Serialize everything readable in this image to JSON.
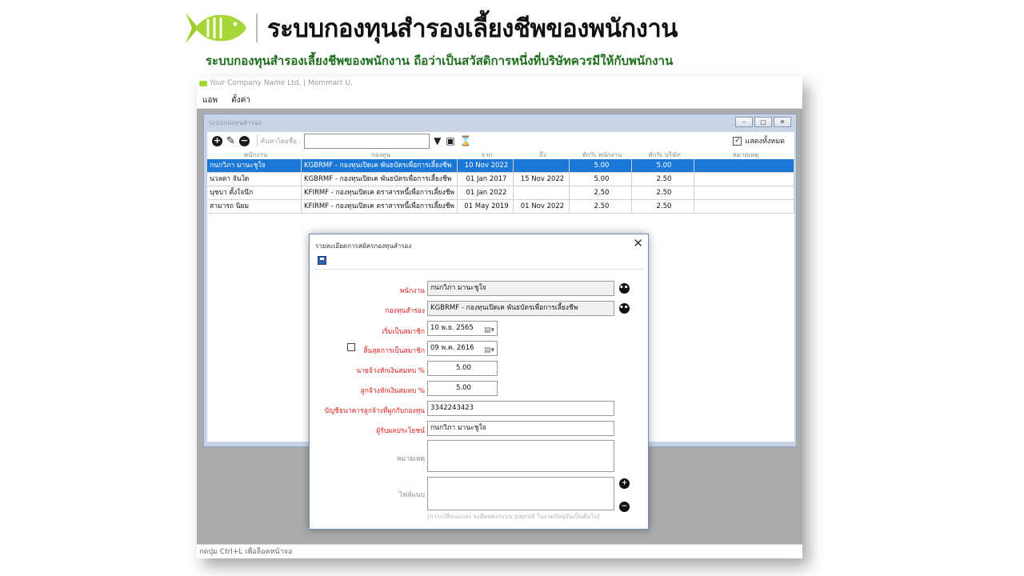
{
  "header": {
    "title": "ระบบกองทุนสำรองเลี้ยงชีพของพนักงาน",
    "subtitle": "ระบบกองทุนสำรองเลี้ยงชีพของพนักงาน ถือว่าเป็นสวัสดิการหนึ่งที่บริษัทควรมีให้กับพนักงาน"
  },
  "app": {
    "window_title": "Your Company Name Ltd. | Mommart U.",
    "menu": [
      "แอพ",
      "ตั้งค่า"
    ],
    "status_text": "กดปุ่ม Ctrl+L เพื่อล็อคหน้าจอ"
  },
  "child_window": {
    "title": "ระบบกองทุนสำรอง",
    "search_label": "ค้นหาโดยชื่อ :",
    "search_value": "",
    "show_all_label": "แสดงทั้งหมด",
    "show_all_checked": true,
    "columns": [
      "พนักงาน",
      "กองทุน",
      "จาก",
      "ถึง",
      "หัก% พนักงาน",
      "หัก% บริษัท",
      "หมายเหตุ"
    ],
    "rows": [
      {
        "employee": "กนกวิภา มานะชูใจ",
        "fund": "KGBRMF - กองทุนเปิดเค พันธบัตรเพื่อการเลี้ยงชีพ",
        "from": "10 Nov 2022",
        "to": "",
        "emp_pct": "5.00",
        "co_pct": "5.00",
        "note": "",
        "selected": true
      },
      {
        "employee": "นวลตา จันใด",
        "fund": "KGBRMF - กองทุนเปิดเค พันธบัตรเพื่อการเลี้ยงชีพ",
        "from": "01 Jan 2017",
        "to": "15 Nov 2022",
        "emp_pct": "5.00",
        "co_pct": "2.50",
        "note": "",
        "selected": false
      },
      {
        "employee": "นุชบา ตั้งใจนึก",
        "fund": "KFIRMF - กองทุนเปิดเค ตราสารหนี้เพื่อการเลี้ยงชีพ",
        "from": "01 Jan 2022",
        "to": "",
        "emp_pct": "2.50",
        "co_pct": "2.50",
        "note": "",
        "selected": false
      },
      {
        "employee": "สามารถ นิยม",
        "fund": "KFIRMF - กองทุนเปิดเค ตราสารหนี้เพื่อการเลี้ยงชีพ",
        "from": "01 May 2019",
        "to": "01 Nov 2022",
        "emp_pct": "2.50",
        "co_pct": "2.50",
        "note": "",
        "selected": false
      }
    ]
  },
  "dialog": {
    "title": "รายละเอียดการสมัครกองทุนสำรอง",
    "employee_label": "พนักงาน",
    "employee_value": "กนกวิภา มานะชูใจ",
    "fund_label": "กองทุนสำรอง",
    "fund_value": "KGBRMF - กองทุนเปิดเค พันธบัตรเพื่อการเลี้ยงชีพ",
    "start_label": "เริ่มเป็นสมาชิก",
    "start_value": "10 พ.ย.  2565",
    "end_label": "สิ้นสุดการเป็นสมาชิก",
    "end_value": "09 พ.ค.  2616",
    "end_checked": false,
    "employer_pct_label": "นายจ้างหักเงินสมทบ %",
    "employer_pct_value": "5.00",
    "employee_pct_label": "ลูกจ้างหักเงินสมทบ %",
    "employee_pct_value": "5.00",
    "account_label": "บัญชีธนาคารลูกจ้างที่ผูกกับกองทุน",
    "account_value": "3342243423",
    "beneficiary_label": "ผู้รับผลประโยชน์",
    "beneficiary_value": "กนกวิภา มานะชูใจ",
    "remark_label": "หมายเหตุ",
    "attachment_label": "ไฟล์แนบ",
    "attachment_note": "(การเปลี่ยนแปลง จะมีผลต่อระบบ payroll ในงวดปัจจุบันเป็นต้นไป)"
  }
}
